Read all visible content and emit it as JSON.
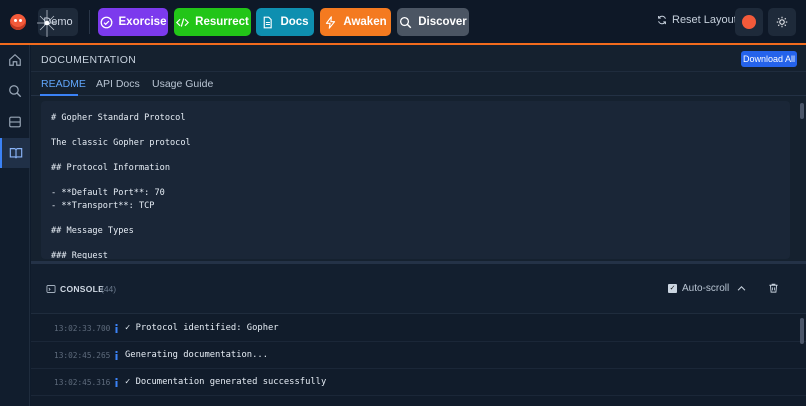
{
  "topbar": {
    "demo_label": "Demo",
    "buttons": [
      {
        "label": "Exorcise",
        "icon": "ghost-icon",
        "color": "#7c3aed"
      },
      {
        "label": "Resurrect",
        "icon": "code-icon",
        "color": "#22c518"
      },
      {
        "label": "Docs",
        "icon": "document-icon",
        "color": "#0e8fb0"
      },
      {
        "label": "Awaken",
        "icon": "bolt-icon",
        "color": "#f47a20"
      },
      {
        "label": "Discover",
        "icon": "search-icon",
        "color": "#4b5563"
      }
    ],
    "reset_label": "Reset Layout",
    "accent_color": "#f26b1d"
  },
  "sidebar": {
    "items": [
      "home-icon",
      "search-icon",
      "storage-icon",
      "book-icon"
    ],
    "active_index": 3
  },
  "documentation": {
    "title": "DOCUMENTATION",
    "download_label": "Download All",
    "tabs": [
      "README",
      "API Docs",
      "Usage Guide"
    ],
    "active_tab": "README",
    "lines": [
      "# Gopher Standard Protocol",
      "The classic Gopher protocol",
      "## Protocol Information",
      "- **Default Port**: 70",
      "- **Transport**: TCP",
      "## Message Types",
      "### Request"
    ]
  },
  "console": {
    "title": "CONSOLE",
    "count": "(44)",
    "autoscroll_label": "Auto-scroll",
    "logs": [
      {
        "time": "13:02:33.700",
        "text": "✓ Protocol identified: Gopher"
      },
      {
        "time": "13:02:45.265",
        "text": "Generating documentation..."
      },
      {
        "time": "13:02:45.316",
        "text": "✓ Documentation generated successfully"
      }
    ]
  }
}
